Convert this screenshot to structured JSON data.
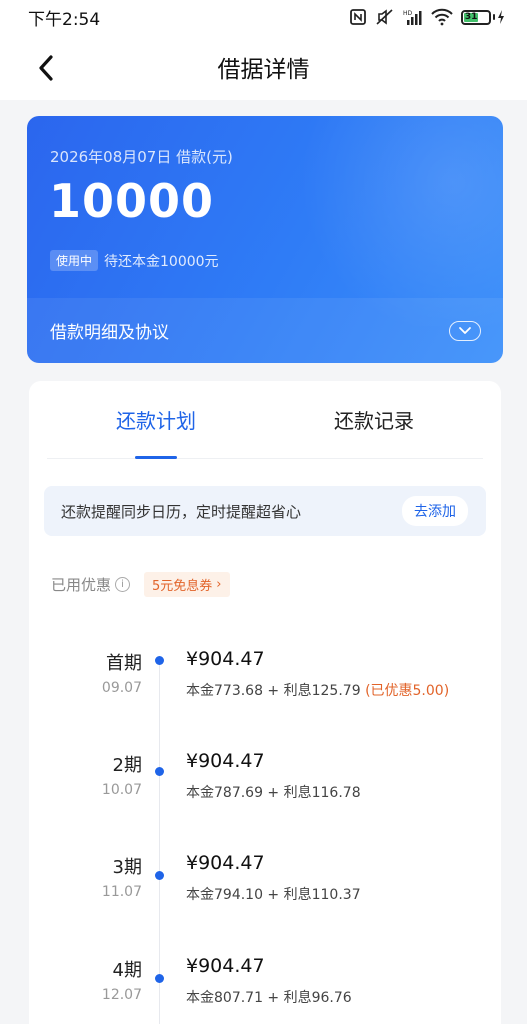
{
  "status_bar": {
    "time": "下午2:54",
    "battery_level": "31",
    "accent": "#43c06b"
  },
  "nav": {
    "title": "借据详情",
    "back_icon": "chevron-left-icon"
  },
  "loan": {
    "date_label": "2026年08月07日 借款(元)",
    "amount": "10000",
    "status_chip": "使用中",
    "status_text": "待还本金10000元",
    "detail_link": "借款明细及协议",
    "card_color": "#2f7cf6"
  },
  "tabs": [
    {
      "label": "还款计划",
      "active": true
    },
    {
      "label": "还款记录",
      "active": false
    }
  ],
  "reminder": {
    "text": "还款提醒同步日历，定时提醒超省心",
    "button": "去添加"
  },
  "discount": {
    "label": "已用优惠",
    "info_icon": "ⓘ",
    "coupon": "5元免息券",
    "coupon_arrow": "›"
  },
  "schedule": [
    {
      "period": "首期",
      "date": "09.07",
      "amount": "¥904.47",
      "breakdown": "本金773.68 + 利息125.79",
      "discount": "(已优惠5.00)"
    },
    {
      "period": "2期",
      "date": "10.07",
      "amount": "¥904.47",
      "breakdown": "本金787.69 + 利息116.78",
      "discount": ""
    },
    {
      "period": "3期",
      "date": "11.07",
      "amount": "¥904.47",
      "breakdown": "本金794.10 + 利息110.37",
      "discount": ""
    },
    {
      "period": "4期",
      "date": "12.07",
      "amount": "¥904.47",
      "breakdown": "本金807.71 + 利息96.76",
      "discount": ""
    }
  ]
}
